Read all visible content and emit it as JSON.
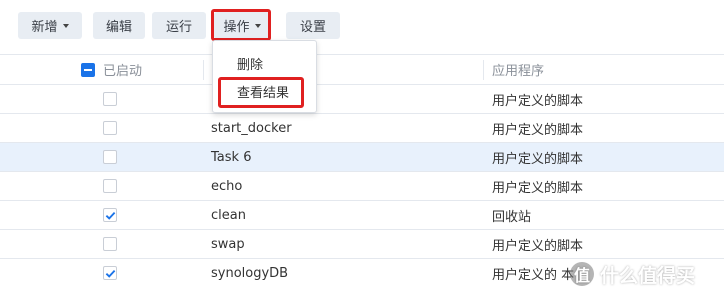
{
  "toolbar": {
    "new_label": "新增",
    "edit_label": "编辑",
    "run_label": "运行",
    "action_label": "操作",
    "settings_label": "设置"
  },
  "table": {
    "headers": {
      "enabled": "已启动",
      "name": "",
      "app": "应用程序"
    },
    "rows": [
      {
        "name": "",
        "app": "用户定义的脚本",
        "checked": false
      },
      {
        "name": "start_docker",
        "app": "用户定义的脚本",
        "checked": false
      },
      {
        "name": "Task 6",
        "app": "用户定义的脚本",
        "checked": false,
        "selected": true
      },
      {
        "name": "echo",
        "app": "用户定义的脚本",
        "checked": false
      },
      {
        "name": "clean",
        "app": "回收站",
        "checked": true
      },
      {
        "name": "swap",
        "app": "用户定义的脚本",
        "checked": false
      },
      {
        "name": "synologyDB",
        "app": "用户定义的 本",
        "checked": true
      }
    ]
  },
  "menu": {
    "items": [
      "删除",
      "查看结果"
    ]
  },
  "watermark": {
    "text": "什么值得买",
    "logo": "值"
  },
  "colors": {
    "accent": "#1a73e8",
    "highlight": "#e02020",
    "selected_row": "#e8f1fc"
  }
}
